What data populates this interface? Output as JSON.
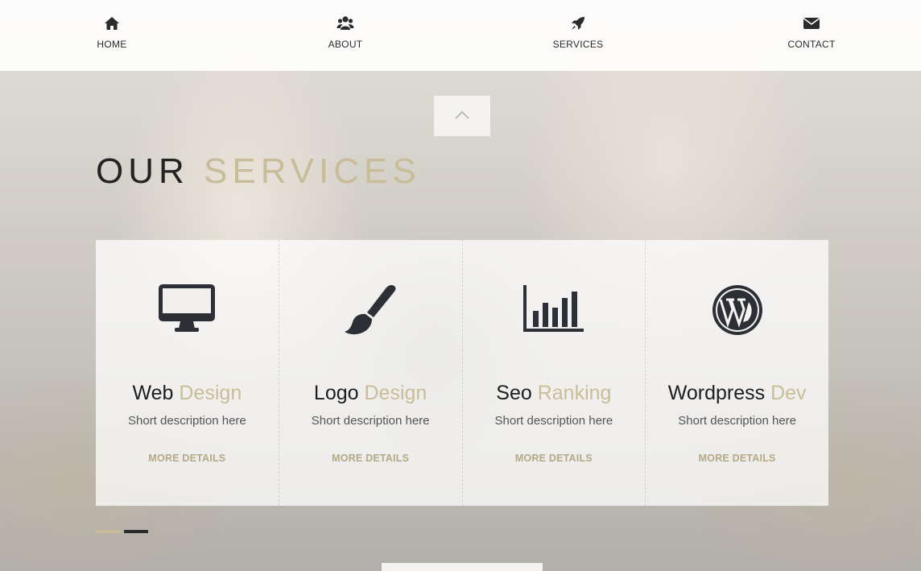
{
  "nav": {
    "items": [
      {
        "label": "HOME",
        "icon": "home-icon"
      },
      {
        "label": "ABOUT",
        "icon": "users-icon"
      },
      {
        "label": "SERVICES",
        "icon": "rocket-icon"
      },
      {
        "label": "CONTACT",
        "icon": "envelope-icon"
      }
    ]
  },
  "section": {
    "title_main": "OUR ",
    "title_accent": "SERVICES"
  },
  "services": [
    {
      "title_main": "Web ",
      "title_accent": "Design",
      "description": "Short description here",
      "link": "MORE DETAILS",
      "icon": "desktop-icon"
    },
    {
      "title_main": "Logo ",
      "title_accent": "Design",
      "description": "Short description here",
      "link": "MORE DETAILS",
      "icon": "paint-brush-icon"
    },
    {
      "title_main": "Seo ",
      "title_accent": "Ranking",
      "description": "Short description here",
      "link": "MORE DETAILS",
      "icon": "bar-chart-icon"
    },
    {
      "title_main": "Wordpress ",
      "title_accent": "Dev",
      "description": "Short description here",
      "link": "MORE DETAILS",
      "icon": "wordpress-icon"
    }
  ],
  "carousel": {
    "active_index": 0,
    "count": 2
  },
  "colors": {
    "accent": "#c8bd98",
    "text_dark": "#232323",
    "link": "#b3a985"
  }
}
